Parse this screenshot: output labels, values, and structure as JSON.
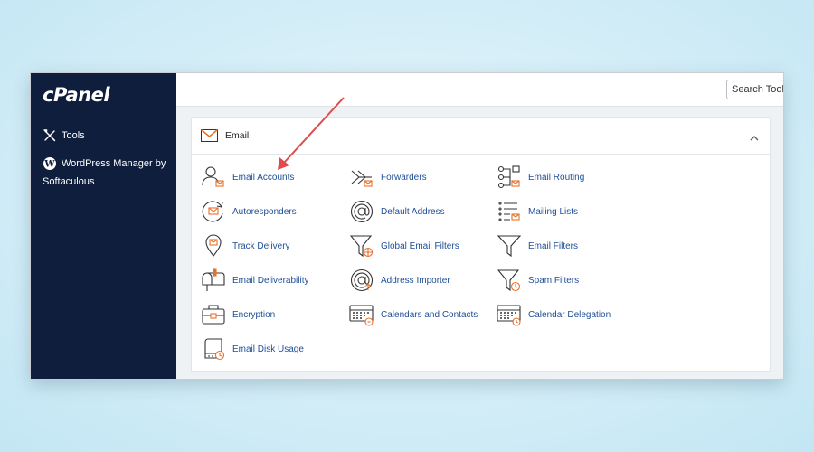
{
  "sidebar": {
    "logo": "cPanel",
    "items": [
      {
        "label": "Tools",
        "icon": "tools-icon"
      },
      {
        "label": "WordPress Manager by Softaculous",
        "icon": "wordpress-icon"
      }
    ]
  },
  "topbar": {
    "search_placeholder": "Search Tools"
  },
  "email_section": {
    "title": "Email",
    "items": [
      {
        "label": "Email Accounts",
        "icon": "user-mail-icon"
      },
      {
        "label": "Forwarders",
        "icon": "forward-icon"
      },
      {
        "label": "Email Routing",
        "icon": "routing-icon"
      },
      {
        "label": "Autoresponders",
        "icon": "autoresponder-icon"
      },
      {
        "label": "Default Address",
        "icon": "at-sign-icon"
      },
      {
        "label": "Mailing Lists",
        "icon": "list-mail-icon"
      },
      {
        "label": "Track Delivery",
        "icon": "location-pin-icon"
      },
      {
        "label": "Global Email Filters",
        "icon": "funnel-globe-icon"
      },
      {
        "label": "Email Filters",
        "icon": "funnel-icon"
      },
      {
        "label": "Email Deliverability",
        "icon": "mailbox-icon"
      },
      {
        "label": "Address Importer",
        "icon": "at-import-icon"
      },
      {
        "label": "Spam Filters",
        "icon": "funnel-clock-icon"
      },
      {
        "label": "Encryption",
        "icon": "briefcase-key-icon"
      },
      {
        "label": "Calendars and Contacts",
        "icon": "calendar-keyboard-icon"
      },
      {
        "label": "Calendar Delegation",
        "icon": "calendar-delegation-icon"
      },
      {
        "label": "Email Disk Usage",
        "icon": "disk-usage-icon"
      }
    ]
  },
  "colors": {
    "sidebar": "#0f1e3d",
    "link": "#1f4e96",
    "accent": "#e8712b",
    "annotation_arrow": "#e04b4b"
  }
}
